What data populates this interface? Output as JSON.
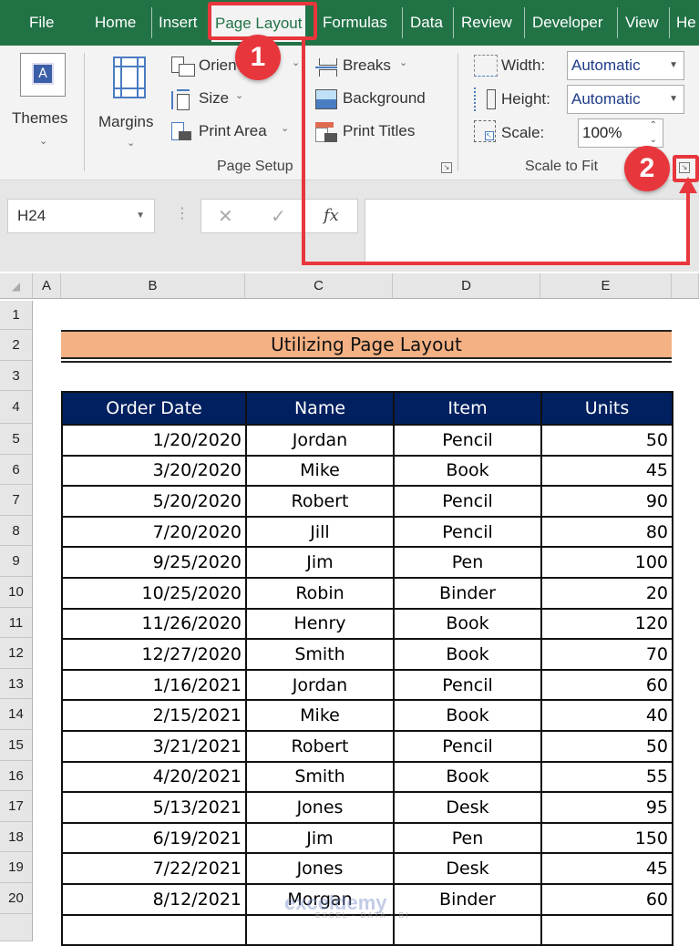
{
  "tabs": [
    {
      "label": "File"
    },
    {
      "label": "Home"
    },
    {
      "label": "Insert"
    },
    {
      "label": "Page Layout",
      "active": true
    },
    {
      "label": "Formulas"
    },
    {
      "label": "Data"
    },
    {
      "label": "Review"
    },
    {
      "label": "Developer"
    },
    {
      "label": "View"
    },
    {
      "label": "He"
    }
  ],
  "ribbon": {
    "themes": {
      "label": "Themes",
      "icon": "themes-icon"
    },
    "margins": {
      "label": "Margins",
      "icon": "margins-icon"
    },
    "orientation": {
      "label": "Orien",
      "icon": "orientation-icon"
    },
    "size": {
      "label": "Size",
      "icon": "size-icon"
    },
    "print_area": {
      "label": "Print Area",
      "icon": "print-area-icon"
    },
    "breaks": {
      "label": "Breaks",
      "icon": "breaks-icon"
    },
    "background": {
      "label": "Background",
      "icon": "background-icon"
    },
    "print_titles": {
      "label": "Print Titles",
      "icon": "print-titles-icon"
    },
    "page_setup_group": "Page Setup",
    "width": {
      "label": "Width:",
      "value": "Automatic"
    },
    "height": {
      "label": "Height:",
      "value": "Automatic"
    },
    "scale": {
      "label": "Scale:",
      "value": "100%"
    },
    "scale_to_fit_group": "Scale to Fit"
  },
  "formula_bar": {
    "name_box": "H24",
    "cancel": "✕",
    "enter": "✓",
    "fx": "fx",
    "value": ""
  },
  "columns": [
    "A",
    "B",
    "C",
    "D",
    "E"
  ],
  "rows": [
    "1",
    "2",
    "3",
    "4",
    "5",
    "6",
    "7",
    "8",
    "9",
    "10",
    "11",
    "12",
    "13",
    "14",
    "15",
    "16",
    "17",
    "18",
    "19",
    "20"
  ],
  "sheet": {
    "title": "Utilizing Page Layout",
    "headers": [
      "Order Date",
      "Name",
      "Item",
      "Units"
    ],
    "records": [
      [
        "1/20/2020",
        "Jordan",
        "Pencil",
        "50"
      ],
      [
        "3/20/2020",
        "Mike",
        "Book",
        "45"
      ],
      [
        "5/20/2020",
        "Robert",
        "Pencil",
        "90"
      ],
      [
        "7/20/2020",
        "Jill",
        "Pencil",
        "80"
      ],
      [
        "9/25/2020",
        "Jim",
        "Pen",
        "100"
      ],
      [
        "10/25/2020",
        "Robin",
        "Binder",
        "20"
      ],
      [
        "11/26/2020",
        "Henry",
        "Book",
        "120"
      ],
      [
        "12/27/2020",
        "Smith",
        "Book",
        "70"
      ],
      [
        "1/16/2021",
        "Jordan",
        "Pencil",
        "60"
      ],
      [
        "2/15/2021",
        "Mike",
        "Book",
        "40"
      ],
      [
        "3/21/2021",
        "Robert",
        "Pencil",
        "50"
      ],
      [
        "4/20/2021",
        "Smith",
        "Book",
        "55"
      ],
      [
        "5/13/2021",
        "Jones",
        "Desk",
        "95"
      ],
      [
        "6/19/2021",
        "Jim",
        "Pen",
        "150"
      ],
      [
        "7/22/2021",
        "Jones",
        "Desk",
        "45"
      ],
      [
        "8/12/2021",
        "Morgan",
        "Binder",
        "60"
      ]
    ]
  },
  "annotations": {
    "step1": "1",
    "step2": "2",
    "color": "#e8363d"
  },
  "watermark": {
    "brand": "exceldemy",
    "tagline": "EXCEL · DATA · BI"
  },
  "colors": {
    "tabbar": "#217346",
    "title_fill": "#f4b183",
    "header_fill": "#002060"
  }
}
